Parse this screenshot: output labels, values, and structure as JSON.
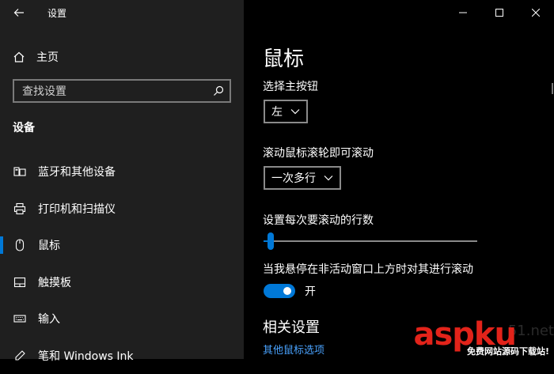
{
  "window": {
    "title": "设置"
  },
  "sidebar": {
    "home_label": "主页",
    "search_placeholder": "查找设置",
    "section_header": "设备",
    "items": [
      {
        "label": "蓝牙和其他设备",
        "icon": "bluetooth-devices-icon",
        "active": false
      },
      {
        "label": "打印机和扫描仪",
        "icon": "printer-icon",
        "active": false
      },
      {
        "label": "鼠标",
        "icon": "mouse-icon",
        "active": true
      },
      {
        "label": "触摸板",
        "icon": "touchpad-icon",
        "active": false
      },
      {
        "label": "输入",
        "icon": "keyboard-icon",
        "active": false
      },
      {
        "label": "笔和 Windows Ink",
        "icon": "pen-icon",
        "active": false
      }
    ]
  },
  "main": {
    "page_title": "鼠标",
    "primary_button": {
      "label": "选择主按钮",
      "value": "左"
    },
    "scroll_mode": {
      "label": "滚动鼠标滚轮即可滚动",
      "value": "一次多行"
    },
    "lines_to_scroll": {
      "label": "设置每次要滚动的行数",
      "value_fraction": 0.02
    },
    "inactive_scroll": {
      "label": "当我悬停在非活动窗口上方时对其进行滚动",
      "state_label": "开",
      "on": true
    },
    "related_settings": {
      "title": "相关设置",
      "link": "其他鼠标选项"
    }
  },
  "watermark": {
    "logo": "aspku",
    "ghost_text": "51.net",
    "sub": "免费网站源码下载站!"
  },
  "colors": {
    "accent": "#0078d7",
    "link": "#4aa3ff",
    "watermark": "#e2231a",
    "sidebar_bg": "#1f1f1f",
    "main_bg": "#000000"
  }
}
